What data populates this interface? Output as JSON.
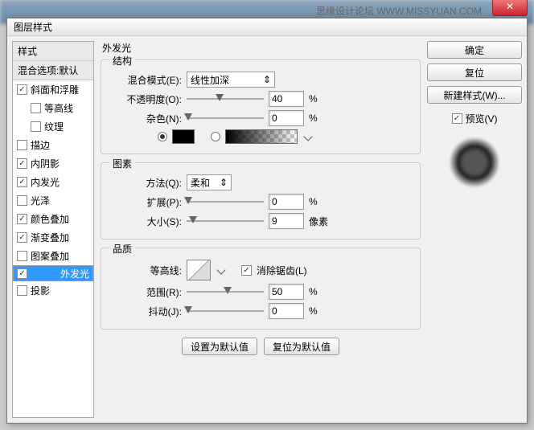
{
  "title": "图层样式",
  "watermark": "思缘设计论坛 WWW.MISSYUAN.COM",
  "sidebar": {
    "header": "样式",
    "blend": "混合选项:默认",
    "items": [
      "斜面和浮雕",
      "等高线",
      "纹理",
      "描边",
      "内阴影",
      "内发光",
      "光泽",
      "颜色叠加",
      "渐变叠加",
      "图案叠加",
      "外发光",
      "投影"
    ]
  },
  "main": {
    "title": "外发光",
    "structure": {
      "legend": "结构",
      "blendmode_label": "混合模式(E):",
      "blendmode": "线性加深",
      "opacity_label": "不透明度(O):",
      "opacity": "40",
      "noise_label": "杂色(N):",
      "noise": "0"
    },
    "elements": {
      "legend": "图素",
      "technique_label": "方法(Q):",
      "technique": "柔和",
      "spread_label": "扩展(P):",
      "spread": "0",
      "size_label": "大小(S):",
      "size": "9"
    },
    "quality": {
      "legend": "品质",
      "contour_label": "等高线:",
      "antialias": "消除锯齿(L)",
      "range_label": "范围(R):",
      "range": "50",
      "jitter_label": "抖动(J):",
      "jitter": "0"
    },
    "make_default": "设置为默认值",
    "reset_default": "复位为默认值"
  },
  "right": {
    "ok": "确定",
    "cancel": "复位",
    "newstyle": "新建样式(W)...",
    "preview": "预览(V)"
  },
  "units": {
    "percent": "%",
    "px": "像素"
  }
}
